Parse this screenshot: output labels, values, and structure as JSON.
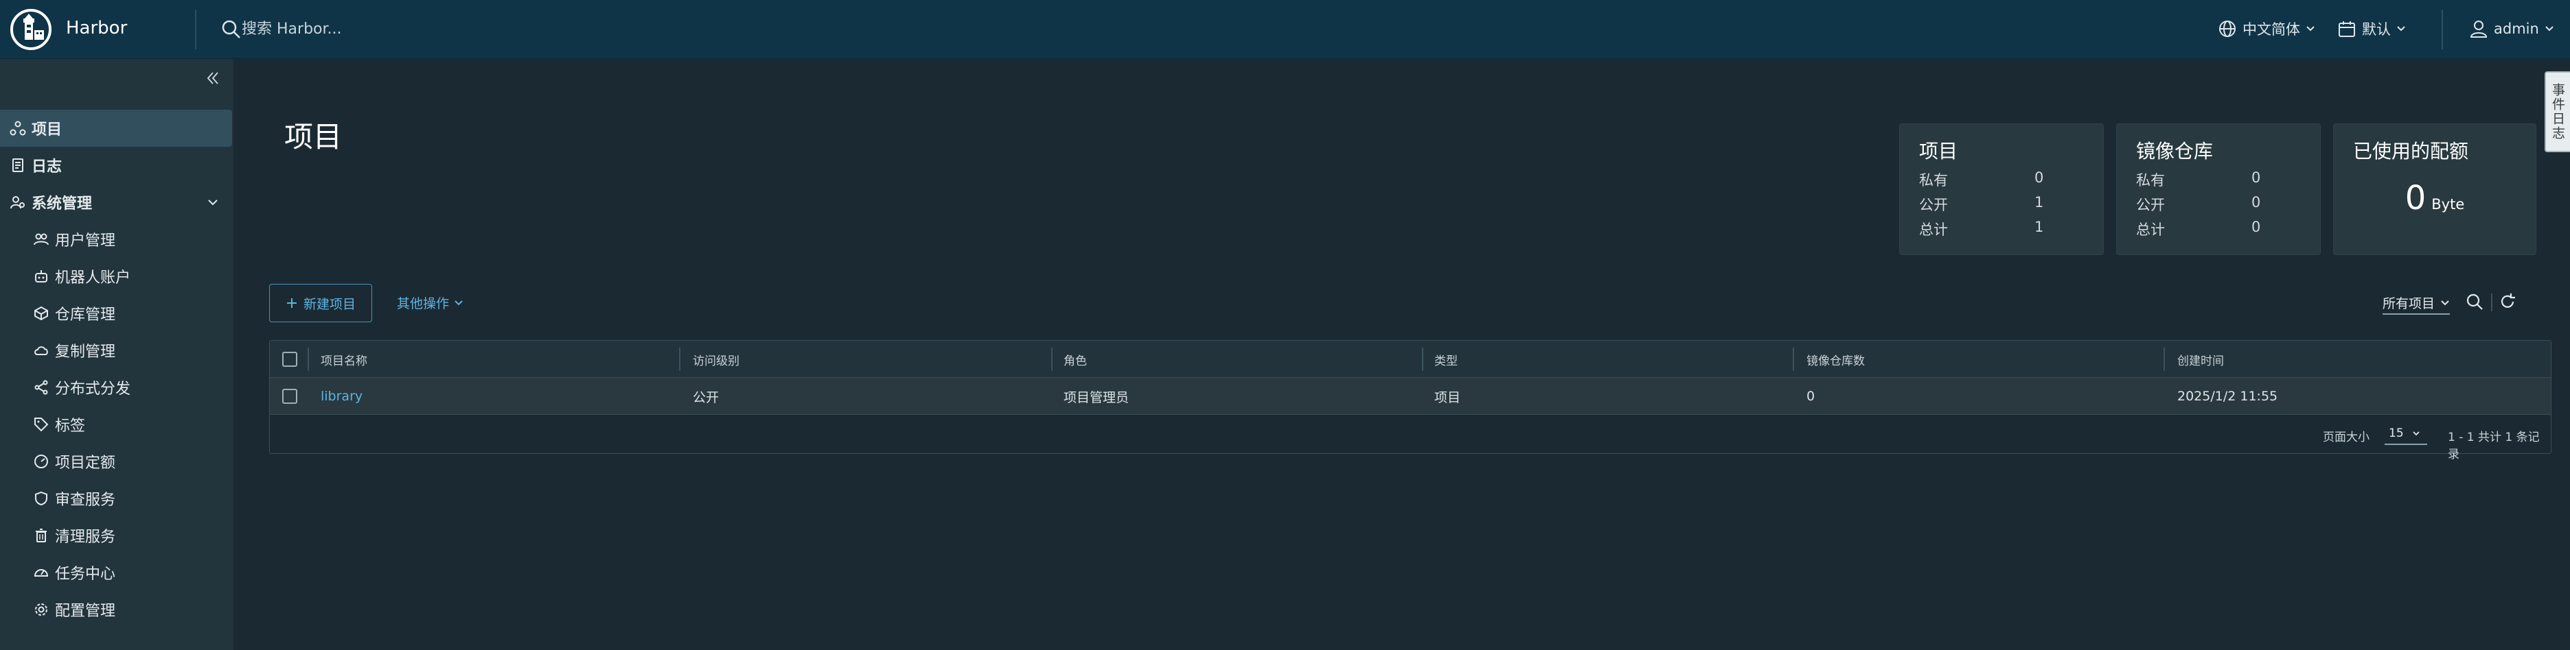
{
  "header": {
    "brand": "Harbor",
    "search_placeholder": "搜索 Harbor...",
    "language": "中文简体",
    "theme": "默认",
    "user": "admin"
  },
  "sidebar": {
    "items": [
      {
        "label": "项目",
        "icon": "projects-icon",
        "active": true
      },
      {
        "label": "日志",
        "icon": "logs-icon"
      },
      {
        "label": "系统管理",
        "icon": "admin-icon",
        "expanded": true
      }
    ],
    "sub_items": [
      {
        "label": "用户管理",
        "icon": "users-icon"
      },
      {
        "label": "机器人账户",
        "icon": "robot-icon"
      },
      {
        "label": "仓库管理",
        "icon": "registry-icon"
      },
      {
        "label": "复制管理",
        "icon": "replication-icon"
      },
      {
        "label": "分布式分发",
        "icon": "distribution-icon"
      },
      {
        "label": "标签",
        "icon": "tag-icon"
      },
      {
        "label": "项目定额",
        "icon": "quota-icon"
      },
      {
        "label": "审查服务",
        "icon": "shield-icon"
      },
      {
        "label": "清理服务",
        "icon": "trash-icon"
      },
      {
        "label": "任务中心",
        "icon": "dashboard-icon"
      },
      {
        "label": "配置管理",
        "icon": "gear-icon"
      }
    ]
  },
  "main": {
    "title": "项目",
    "cards": {
      "projects": {
        "title": "项目",
        "rows": [
          {
            "label": "私有",
            "value": "0"
          },
          {
            "label": "公开",
            "value": "1"
          },
          {
            "label": "总计",
            "value": "1"
          }
        ]
      },
      "repositories": {
        "title": "镜像仓库",
        "rows": [
          {
            "label": "私有",
            "value": "0"
          },
          {
            "label": "公开",
            "value": "0"
          },
          {
            "label": "总计",
            "value": "0"
          }
        ]
      },
      "quota": {
        "title": "已使用的配额",
        "value": "0",
        "unit": "Byte"
      }
    },
    "toolbar": {
      "new_project": "新建项目",
      "more_actions": "其他操作",
      "filter": "所有项目"
    },
    "table": {
      "columns": [
        "项目名称",
        "访问级别",
        "角色",
        "类型",
        "镜像仓库数",
        "创建时间"
      ],
      "rows": [
        {
          "name": "library",
          "access": "公开",
          "role": "项目管理员",
          "type": "项目",
          "repo_count": "0",
          "created": "2025/1/2 11:55"
        }
      ],
      "footer": {
        "page_size_label": "页面大小",
        "page_size": "15",
        "summary": "1 - 1 共计 1 条记录"
      }
    },
    "event_tab": "事件日志"
  },
  "colors": {
    "header_bg": "#0f3447",
    "sidebar_bg": "#22343c",
    "main_bg": "#1b2a32",
    "accent": "#5fb3e4",
    "active_nav": "#324f5e"
  }
}
